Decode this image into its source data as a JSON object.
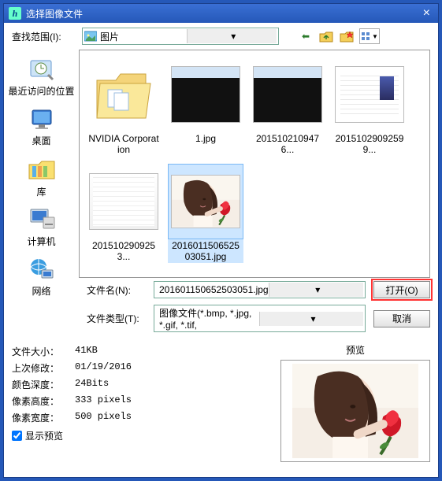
{
  "title": "选择图像文件",
  "lookin": {
    "label": "查找范围(I):",
    "value": "图片"
  },
  "nav_icons": [
    "back-arrow",
    "up-folder",
    "new-folder",
    "view-menu"
  ],
  "places": [
    {
      "label": "最近访问的位置"
    },
    {
      "label": "桌面"
    },
    {
      "label": "库"
    },
    {
      "label": "计算机"
    },
    {
      "label": "网络"
    }
  ],
  "files": [
    {
      "name": "NVIDIA Corporation",
      "kind": "folder"
    },
    {
      "name": "1.jpg",
      "kind": "dark"
    },
    {
      "name": "2015102109476...",
      "kind": "dark"
    },
    {
      "name": "20151029092599...",
      "kind": "settings"
    },
    {
      "name": "2015102909253...",
      "kind": "soft"
    },
    {
      "name": "201601150652503051.jpg",
      "kind": "girl",
      "selected": true
    }
  ],
  "filename": {
    "label": "文件名(N):",
    "value": "201601150652503051.jpg"
  },
  "filetype": {
    "label": "文件类型(T):",
    "value": "图像文件(*.bmp, *.jpg, *.gif, *.tif,"
  },
  "buttons": {
    "open": "打开(O)",
    "cancel": "取消"
  },
  "meta": [
    {
      "k": "文件大小：",
      "v": "41KB"
    },
    {
      "k": "上次修改：",
      "v": "01/19/2016"
    },
    {
      "k": "颜色深度：",
      "v": "24Bits"
    },
    {
      "k": "像素高度：",
      "v": "333 pixels"
    },
    {
      "k": "像素宽度：",
      "v": "500 pixels"
    }
  ],
  "show_preview": "显示预览",
  "preview_label": "预览"
}
